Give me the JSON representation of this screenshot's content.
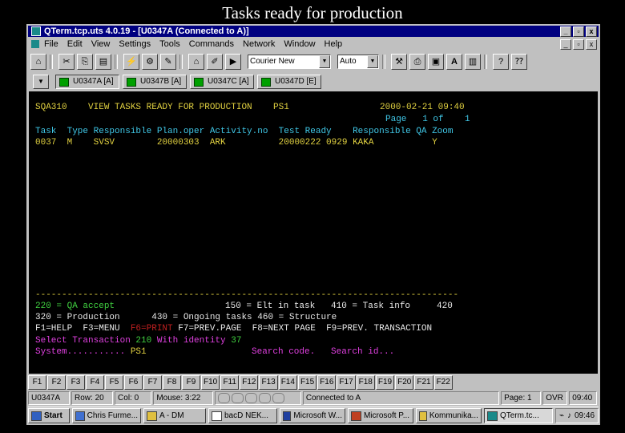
{
  "slide_title": "Tasks ready for production",
  "window": {
    "title": "QTerm.tcp.uts 4.0.19 - [U0347A (Connected to A)]",
    "buttons": [
      "_",
      "▫",
      "x"
    ],
    "mdi_buttons": [
      "_",
      "▫",
      "x"
    ]
  },
  "menu": [
    "File",
    "Edit",
    "View",
    "Settings",
    "Tools",
    "Commands",
    "Network",
    "Window",
    "Help"
  ],
  "toolbar": {
    "font_combo": "Courier New",
    "size_combo": "Auto",
    "font_bold_label": "A"
  },
  "sessions": [
    {
      "label": "U0347A [A]",
      "active": true
    },
    {
      "label": "U0347B [A]",
      "active": false
    },
    {
      "label": "U0347C [A]",
      "active": false
    },
    {
      "label": "U0347D [E]",
      "active": false
    }
  ],
  "terminal": {
    "header_left": "SQA310    VIEW TASKS READY FOR PRODUCTION    PS1",
    "header_right": "2000-02-21 09:40",
    "page_line": "Page   1 of    1",
    "col_headers": "Task  Type Responsible Plan.oper Activity.no  Test Ready    Responsible QA Zoom",
    "row_1": "0037  M    SVSV        20000303  ARK          20000222 0929 KAKA           Y",
    "separator": "--------------------------------------------------------------------------------",
    "legend_1a": "220 = QA accept",
    "legend_1b": "150 = Elt in task   410 = Task info     420",
    "legend_2": "320 = Production      430 = Ongoing tasks 460 = Structure",
    "fkeys_a": "F1=HELP  F3=MENU  ",
    "fkeys_b": "F6=PRINT",
    "fkeys_c": " F7=PREV.PAGE  F8=NEXT PAGE  F9=PREV. TRANSACTION",
    "select_a": "Select Transaction ",
    "select_b": "210",
    "select_c": " With identity ",
    "select_d": "37",
    "system_a": "System........... ",
    "system_b": "PS1",
    "system_c": "Search code.   Search id..."
  },
  "function_keys": [
    "F1",
    "F2",
    "F3",
    "F4",
    "F5",
    "F6",
    "F7",
    "F8",
    "F9",
    "F10",
    "F11",
    "F12",
    "F13",
    "F14",
    "F15",
    "F16",
    "F17",
    "F18",
    "F19",
    "F20",
    "F21",
    "F22"
  ],
  "status": {
    "session": "U0347A",
    "row": "Row: 20",
    "col": "Col: 0",
    "mouse": "Mouse: 3:22",
    "connection": "Connected to A",
    "page": "Page: 1",
    "ovr": "OVR",
    "clock": "09:40"
  },
  "taskbar": {
    "start": "Start",
    "items": [
      "Chris Furme...",
      "A - DM",
      "bacD NEK...",
      "Microsoft W...",
      "Microsoft P...",
      "Kommunika...",
      "QTerm.tc..."
    ],
    "clock": "09:46"
  }
}
